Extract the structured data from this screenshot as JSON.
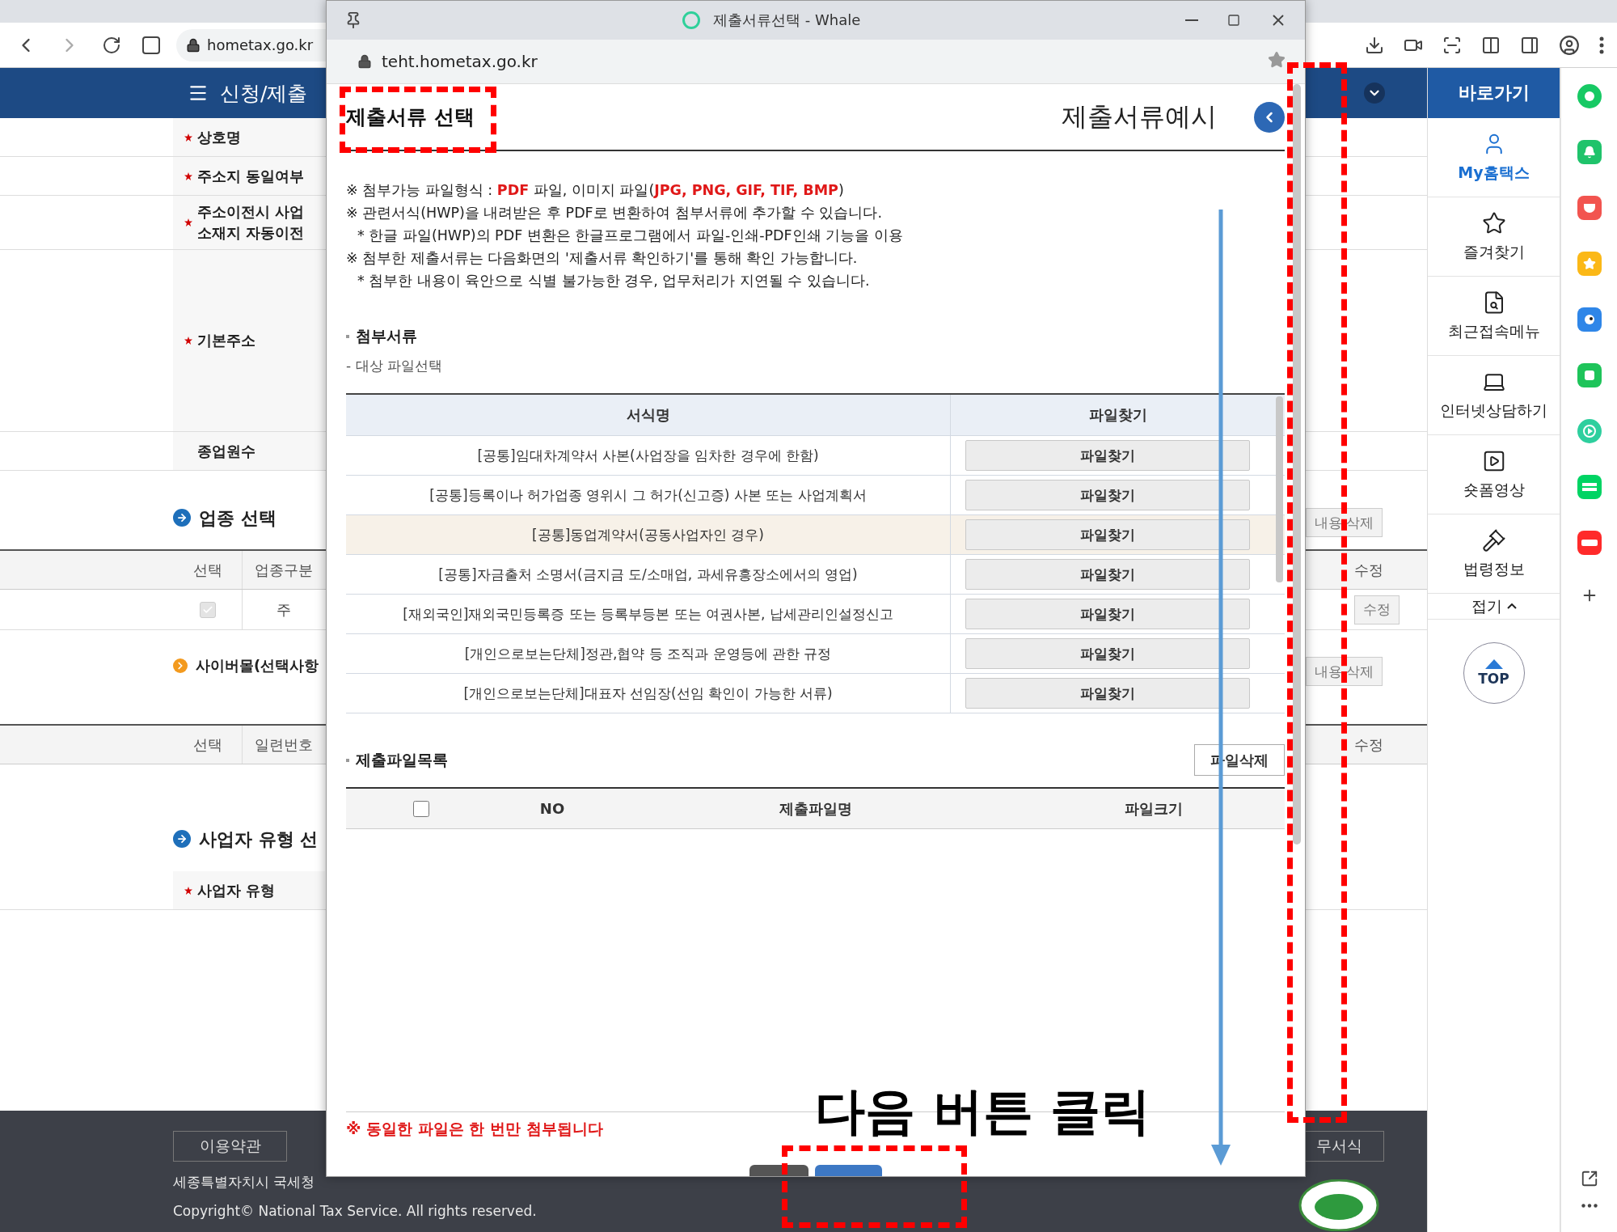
{
  "browser": {
    "address": "hometax.go.kr"
  },
  "page": {
    "menu_title": "신청/제출",
    "form": [
      {
        "kind": "field",
        "label": [
          "상호명"
        ],
        "required": true
      },
      {
        "kind": "field",
        "label": [
          "주소지 동일여부"
        ],
        "required": true
      },
      {
        "kind": "field",
        "label": [
          "주소이전시 사업",
          "소재지 자동이전"
        ],
        "required": true
      },
      {
        "kind": "address",
        "label": [
          "기본주소"
        ],
        "required": true
      },
      {
        "kind": "field",
        "label": [
          "종업원수"
        ],
        "required": false
      },
      {
        "kind": "section",
        "title": "업종 선택",
        "right_button": "내용 삭제"
      },
      {
        "kind": "table_header",
        "cells": [
          "선택",
          "업종구분"
        ],
        "right": "수정"
      },
      {
        "kind": "table_row",
        "checked": true,
        "cells": [
          "주"
        ],
        "right_button": "수정"
      },
      {
        "kind": "subsection",
        "title": "사이버몰(선택사항",
        "right_button": "내용 삭제"
      },
      {
        "kind": "table_header",
        "cells": [
          "선택",
          "일련번호"
        ],
        "right": "수정"
      },
      {
        "kind": "section",
        "title": "사업자 유형 선"
      },
      {
        "kind": "field",
        "label": [
          "사업자 유형"
        ],
        "required": true
      }
    ],
    "footer": {
      "left_button": "이용약관",
      "right_button": "무서식",
      "address": "세종특별자치시 국세청",
      "copyright": "Copyright© National Tax Service. All rights reserved."
    }
  },
  "quick_menu": {
    "title": "바로가기",
    "items": [
      {
        "label": "My홈택스",
        "selected": true
      },
      {
        "label": "즐겨찾기",
        "selected": false
      },
      {
        "label": "최근접속메뉴",
        "selected": false
      },
      {
        "label": "인터넷상담하기",
        "selected": false
      },
      {
        "label": "숏폼영상",
        "selected": false
      },
      {
        "label": "법령정보",
        "selected": false
      }
    ],
    "collapse": "접기",
    "top": "TOP"
  },
  "side_apps": [
    {
      "kind": "ring",
      "color": "#17c964"
    },
    {
      "kind": "bell",
      "color": "#1fc36b"
    },
    {
      "kind": "pocket",
      "color": "#f2544f"
    },
    {
      "kind": "star",
      "color": "#fbb817"
    },
    {
      "kind": "bird",
      "color": "#2f86e8"
    },
    {
      "kind": "square",
      "color": "#1ec45a"
    },
    {
      "kind": "play",
      "color": "#2ecf9e"
    },
    {
      "kind": "webtoon",
      "color": "#00d463"
    },
    {
      "kind": "now",
      "color": "#ff2a2a"
    }
  ],
  "popup": {
    "window_title": "제출서류선택 - Whale",
    "address": "teht.hometax.go.kr",
    "heading": "제출서류 선택",
    "example_link": "제출서류예시",
    "notes": [
      {
        "kind": "main",
        "text": "※ 첨부가능 파일형식 : **PDF** 파일, 이미지 파일(**JPG, PNG, GIF, TIF, BMP**)"
      },
      {
        "kind": "main",
        "text": "※ 관련서식(HWP)을 내려받은 후 PDF로 변환하여 첨부서류에 추가할 수 있습니다."
      },
      {
        "kind": "sub",
        "text": "* 한글 파일(HWP)의 PDF 변환은 한글프로그램에서 파일-인쇄-PDF인쇄 기능을 이용"
      },
      {
        "kind": "main",
        "text": "※ 첨부한 제출서류는 다음화면의 '제출서류 확인하기'를 통해 확인 가능합니다."
      },
      {
        "kind": "sub",
        "text": "* 첨부한 내용이 육안으로 식별 불가능한 경우, 업무처리가 지연될 수 있습니다."
      }
    ],
    "attach": {
      "title": "첨부서류",
      "subtitle": "- 대상 파일선택",
      "columns": [
        "서식명",
        "파일찾기"
      ],
      "rows": [
        {
          "name": "[공통]임대차계약서 사본(사업장을 임차한 경우에 한함)",
          "button": "파일찾기",
          "selected": false
        },
        {
          "name": "[공통]등록이나 허가업종 영위시 그 허가(신고증) 사본 또는 사업계획서",
          "button": "파일찾기",
          "selected": false
        },
        {
          "name": "[공통]동업계약서(공동사업자인 경우)",
          "button": "파일찾기",
          "selected": true
        },
        {
          "name": "[공통]자금출처 소명서(금지금 도/소매업, 과세유흥장소에서의 영업)",
          "button": "파일찾기",
          "selected": false
        },
        {
          "name": "[재외국인]재외국민등록증 또는 등록부등본 또는 여권사본, 납세관리인설정신고",
          "button": "파일찾기",
          "selected": false
        },
        {
          "name": "[개인으로보는단체]정관,협약 등 조직과 운영등에 관한 규정",
          "button": "파일찾기",
          "selected": false
        },
        {
          "name": "[개인으로보는단체]대표자 선임장(선임 확인이 가능한 서류)",
          "button": "파일찾기",
          "selected": false
        }
      ]
    },
    "files": {
      "title": "제출파일목록",
      "delete_button": "파일삭제",
      "select_all_checked": false,
      "columns": [
        "NO",
        "제출파일명",
        "파일크기"
      ]
    },
    "notice": "※ 동일한 파일은 한 번만 첨부됩니다"
  },
  "annotation": {
    "callout": "다음 버튼 클릭"
  }
}
